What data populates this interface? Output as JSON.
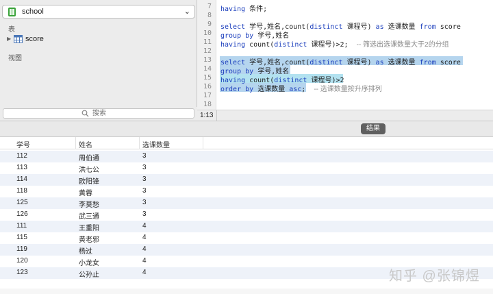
{
  "sidebar": {
    "database": "school",
    "tables_label": "表",
    "tables": [
      "score"
    ],
    "views_label": "视图",
    "search_placeholder": "搜索"
  },
  "editor": {
    "line_numbers": [
      "7",
      "8",
      "9",
      "10",
      "11",
      "12",
      "13",
      "14",
      "15",
      "16",
      "17",
      "18"
    ],
    "lines": {
      "l7_kw": "having",
      "l7_text": " 条件;",
      "l9_kw1": "select",
      "l9_text1": " 学号,姓名,count(",
      "l9_kw2": "distinct",
      "l9_text2": " 课程号) ",
      "l9_kw3": "as",
      "l9_text3": " 选课数量 ",
      "l9_kw4": "from",
      "l9_text4": " score",
      "l10_kw": "group by",
      "l10_text": " 学号,姓名",
      "l11_kw1": "having",
      "l11_text1": " count(",
      "l11_kw2": "distinct",
      "l11_text2": " 课程号)>2;  ",
      "l11_cmt": "-- 筛选出选课数量大于2的分组",
      "l13_kw1": "select",
      "l13_text1": " 学号,姓名,count(",
      "l13_kw2": "distinct",
      "l13_text2": " 课程号) ",
      "l13_kw3": "as",
      "l13_text3": " 选课数量 ",
      "l13_kw4": "from",
      "l13_text4": " score",
      "l14_kw": "group by",
      "l14_text": " 学号,姓名",
      "l15_kw1": "having",
      "l15_text1": " count(",
      "l15_kw2": "distinct",
      "l15_text2": " 课程号)>2",
      "l16_kw1": "order by",
      "l16_text1": " 选课数量 ",
      "l16_kw2": "asc",
      "l16_text2": ";  ",
      "l16_cmt": "-- 选课数量按升序排列"
    },
    "cursor_position": "1:13"
  },
  "results": {
    "tab_label": "结果",
    "columns": [
      "学号",
      "姓名",
      "选课数量"
    ],
    "rows": [
      [
        "112",
        "周伯通",
        "3"
      ],
      [
        "113",
        "洪七公",
        "3"
      ],
      [
        "114",
        "欧阳锋",
        "3"
      ],
      [
        "118",
        "黄蓉",
        "3"
      ],
      [
        "125",
        "李莫愁",
        "3"
      ],
      [
        "126",
        "武三通",
        "3"
      ],
      [
        "111",
        "王重阳",
        "4"
      ],
      [
        "115",
        "黄老邪",
        "4"
      ],
      [
        "119",
        "杨过",
        "4"
      ],
      [
        "120",
        "小龙女",
        "4"
      ],
      [
        "123",
        "公孙止",
        "4"
      ]
    ]
  },
  "watermark": "知乎 @张锦煜",
  "colors": {
    "keyword": "#1c3fbd",
    "selection": "#b5d5ee",
    "row_stripe": "#eef2f9",
    "results_tab": "#5f5f5f"
  }
}
